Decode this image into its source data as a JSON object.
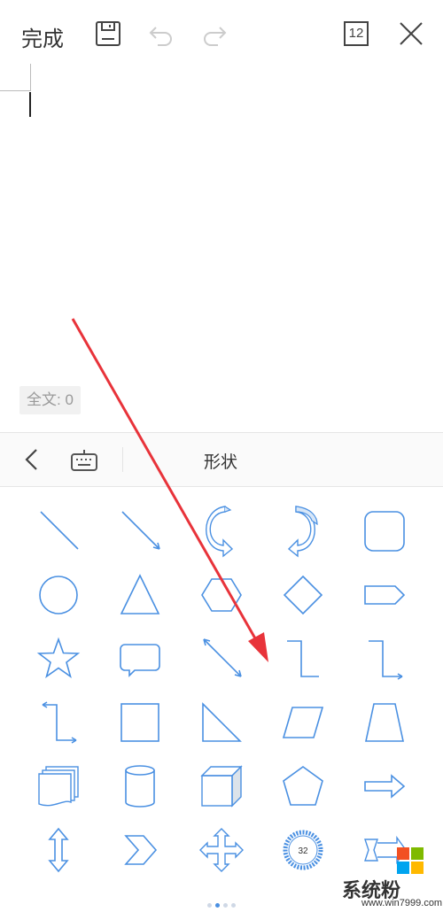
{
  "toolbar": {
    "done_label": "完成",
    "page_badge": "12"
  },
  "editor": {
    "word_count": "全文: 0"
  },
  "panel": {
    "title": "形状",
    "shape_badge_number": "32"
  },
  "pager": {
    "total": 4,
    "active": 1
  },
  "watermark": {
    "site": "系统粉",
    "url": "www.win7999.com"
  },
  "colors": {
    "accent": "#4a90e2",
    "annotation_arrow": "#e8333a"
  },
  "icons": {
    "toolbar": [
      "save-icon",
      "undo-icon",
      "redo-icon",
      "page-count-icon",
      "close-icon"
    ],
    "panel": [
      "back-icon",
      "keyboard-icon"
    ],
    "shapes": [
      "line-icon",
      "arrow-line-icon",
      "curved-arrow-left-icon",
      "curved-arrow-right-icon",
      "rounded-rectangle-icon",
      "circle-icon",
      "triangle-icon",
      "hexagon-icon",
      "diamond-icon",
      "pentagon-arrow-icon",
      "star-icon",
      "speech-bubble-icon",
      "double-arrow-line-icon",
      "elbow-connector-icon",
      "elbow-arrow-connector-icon",
      "elbow-double-arrow-connector-icon",
      "square-icon",
      "right-triangle-icon",
      "parallelogram-icon",
      "trapezoid-icon",
      "multi-document-icon",
      "cylinder-icon",
      "cube-icon",
      "pentagon-icon",
      "block-arrow-right-icon",
      "double-arrow-vertical-icon",
      "chevron-icon",
      "four-way-arrow-icon",
      "seal-badge-icon",
      "banner-arrow-icon"
    ]
  }
}
